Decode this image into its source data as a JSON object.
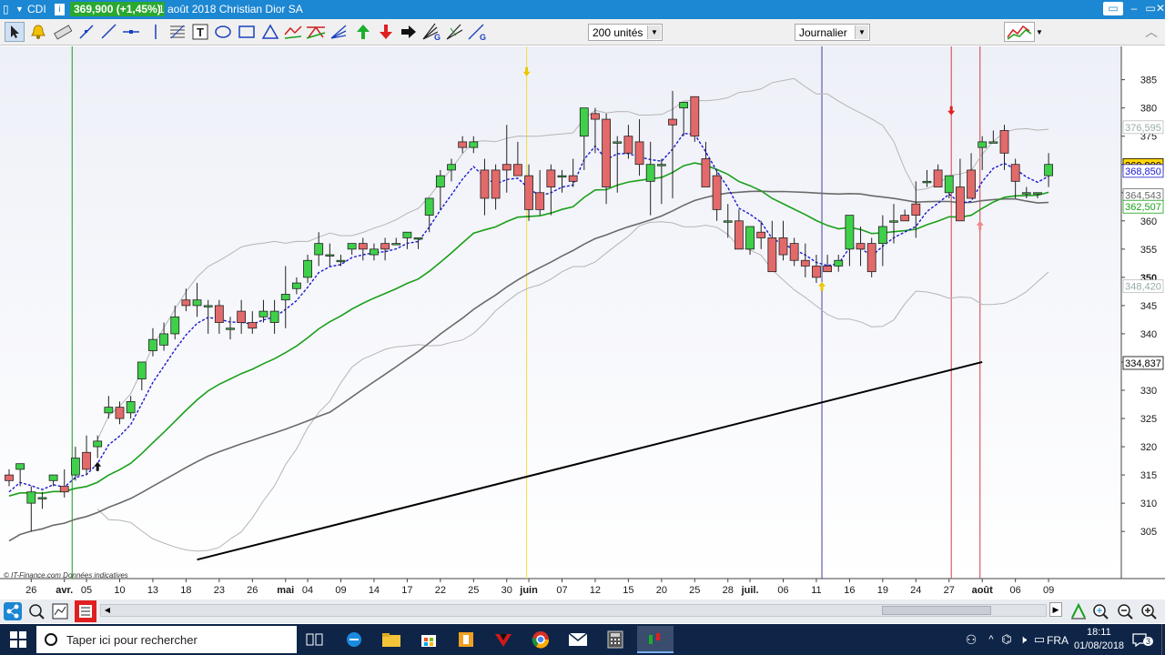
{
  "window": {
    "symbol": "CDI",
    "quote": "369,900 (+1,45%)",
    "title": "1 août 2018 Christian Dior SA",
    "controls": [
      "–",
      "▭",
      "✕"
    ]
  },
  "toolbar": {
    "units_value": "200 unités",
    "period_value": "Journalier"
  },
  "chart_data": {
    "type": "candlestick",
    "copyright": "© IT-Finance.com  Données indicatives",
    "ylim": [
      301,
      388
    ],
    "y_ticks": [
      305,
      310,
      315,
      320,
      325,
      330,
      335,
      340,
      345,
      350,
      355,
      360,
      365,
      370,
      375,
      380,
      385
    ],
    "x_labels": [
      {
        "i": 2,
        "t": "26"
      },
      {
        "i": 5,
        "t": "avr.",
        "bold": true
      },
      {
        "i": 7,
        "t": "05"
      },
      {
        "i": 10,
        "t": "10"
      },
      {
        "i": 13,
        "t": "13"
      },
      {
        "i": 16,
        "t": "18"
      },
      {
        "i": 19,
        "t": "23"
      },
      {
        "i": 22,
        "t": "26"
      },
      {
        "i": 25,
        "t": "mai",
        "bold": true
      },
      {
        "i": 27,
        "t": "04"
      },
      {
        "i": 30,
        "t": "09"
      },
      {
        "i": 33,
        "t": "14"
      },
      {
        "i": 36,
        "t": "17"
      },
      {
        "i": 39,
        "t": "22"
      },
      {
        "i": 42,
        "t": "25"
      },
      {
        "i": 45,
        "t": "30"
      },
      {
        "i": 47,
        "t": "juin",
        "bold": true
      },
      {
        "i": 50,
        "t": "07"
      },
      {
        "i": 53,
        "t": "12"
      },
      {
        "i": 56,
        "t": "15"
      },
      {
        "i": 59,
        "t": "20"
      },
      {
        "i": 62,
        "t": "25"
      },
      {
        "i": 65,
        "t": "28"
      },
      {
        "i": 67,
        "t": "juil.",
        "bold": true
      },
      {
        "i": 70,
        "t": "06"
      },
      {
        "i": 73,
        "t": "11"
      },
      {
        "i": 76,
        "t": "16"
      },
      {
        "i": 79,
        "t": "19"
      },
      {
        "i": 82,
        "t": "24"
      },
      {
        "i": 85,
        "t": "27"
      },
      {
        "i": 88,
        "t": "août",
        "bold": true
      },
      {
        "i": 91,
        "t": "06"
      },
      {
        "i": 94,
        "t": "09"
      }
    ],
    "candles": [
      [
        315,
        316,
        313,
        314
      ],
      [
        316,
        317,
        313,
        317
      ],
      [
        310,
        313,
        305,
        312
      ],
      [
        311,
        312,
        309,
        311
      ],
      [
        314,
        315,
        313,
        315
      ],
      [
        313,
        316,
        311,
        312
      ],
      [
        315,
        320,
        314,
        318
      ],
      [
        319,
        322,
        315,
        316
      ],
      [
        320,
        322,
        318,
        321
      ],
      [
        326,
        329,
        325,
        327
      ],
      [
        327,
        328,
        324,
        325
      ],
      [
        326,
        329,
        325,
        328
      ],
      [
        332,
        335,
        330,
        335
      ],
      [
        337,
        341,
        336,
        339
      ],
      [
        338,
        342,
        337,
        340
      ],
      [
        340,
        345,
        339,
        343
      ],
      [
        346,
        348,
        344,
        345
      ],
      [
        345,
        349,
        343,
        346
      ],
      [
        345,
        346,
        340,
        345
      ],
      [
        345,
        346,
        340,
        342
      ],
      [
        341,
        343,
        339,
        341
      ],
      [
        344,
        346,
        340,
        342
      ],
      [
        342,
        344,
        340,
        341
      ],
      [
        343,
        346,
        342,
        344
      ],
      [
        342,
        346,
        340,
        344
      ],
      [
        346,
        352,
        341,
        347
      ],
      [
        348,
        350,
        347,
        349
      ],
      [
        350,
        354,
        349,
        353
      ],
      [
        354,
        358,
        352,
        356
      ],
      [
        354,
        356,
        352,
        354
      ],
      [
        353,
        354,
        352,
        353
      ],
      [
        355,
        356,
        354,
        356
      ],
      [
        356,
        357,
        353,
        355
      ],
      [
        354,
        356,
        353,
        355
      ],
      [
        356,
        357,
        353,
        355
      ],
      [
        356,
        357,
        356,
        356
      ],
      [
        357,
        358,
        355,
        358
      ],
      [
        357,
        357,
        355,
        357
      ],
      [
        361,
        364,
        358,
        364
      ],
      [
        366,
        369,
        362,
        368
      ],
      [
        369,
        371,
        367,
        370
      ],
      [
        374,
        375,
        372,
        373
      ],
      [
        373,
        375,
        372,
        374
      ],
      [
        369,
        371,
        361,
        364
      ],
      [
        369,
        370,
        362,
        364
      ],
      [
        370,
        377,
        365,
        369
      ],
      [
        370,
        374,
        368,
        368
      ],
      [
        368,
        370,
        360,
        362
      ],
      [
        365,
        369,
        361,
        362
      ],
      [
        369,
        370,
        361,
        366
      ],
      [
        368,
        369,
        365,
        368
      ],
      [
        368,
        371,
        366,
        367
      ],
      [
        375,
        380,
        369,
        380
      ],
      [
        379,
        380,
        372,
        378
      ],
      [
        378,
        379,
        363,
        366
      ],
      [
        374,
        375,
        365,
        374
      ],
      [
        375,
        377,
        371,
        372
      ],
      [
        374,
        378,
        368,
        370
      ],
      [
        367,
        374,
        361,
        370
      ],
      [
        370,
        371,
        363,
        370
      ],
      [
        378,
        383,
        364,
        377
      ],
      [
        380,
        381,
        375,
        381
      ],
      [
        382,
        382,
        374,
        375
      ],
      [
        371,
        374,
        367,
        366
      ],
      [
        368,
        369,
        360,
        362
      ],
      [
        360,
        363,
        357,
        360
      ],
      [
        360,
        362,
        356,
        355
      ],
      [
        355,
        359,
        354,
        359
      ],
      [
        358,
        360,
        355,
        357
      ],
      [
        357,
        360,
        351,
        351
      ],
      [
        357,
        360,
        353,
        354
      ],
      [
        356,
        357,
        352,
        353
      ],
      [
        353,
        356,
        350,
        352
      ],
      [
        352,
        354,
        349,
        350
      ],
      [
        352,
        354,
        351,
        351
      ],
      [
        352,
        354,
        351,
        353
      ],
      [
        355,
        361,
        352,
        361
      ],
      [
        356,
        359,
        352,
        355
      ],
      [
        356,
        357,
        350,
        351
      ],
      [
        356,
        361,
        352,
        359
      ],
      [
        360,
        363,
        356,
        360
      ],
      [
        361,
        362,
        360,
        360
      ],
      [
        363,
        367,
        357,
        361
      ],
      [
        367,
        369,
        366,
        367
      ],
      [
        369,
        370,
        368,
        366
      ],
      [
        365,
        368,
        364,
        368
      ],
      [
        366,
        371,
        362,
        360
      ],
      [
        369,
        372,
        367,
        364
      ],
      [
        373,
        375,
        369,
        374
      ],
      [
        374,
        376,
        374,
        374
      ],
      [
        376,
        377,
        369,
        372
      ],
      [
        370,
        371,
        364,
        367
      ],
      [
        365,
        366,
        364,
        365
      ],
      [
        365,
        365,
        364,
        365
      ],
      [
        368,
        372,
        366,
        370
      ]
    ],
    "overlays": {
      "mm200": {
        "from": 17,
        "to": 88,
        "start": 300,
        "end": 335,
        "color": "#000000"
      },
      "mm50": {
        "from": 0,
        "to": 88,
        "color": "#6a6a6a"
      },
      "mm20": {
        "from": 0,
        "to": 88,
        "color": "#1aa01a"
      },
      "mm5": {
        "from": 0,
        "to": 88,
        "color": "#1a1ad0"
      },
      "bollinger": {
        "color": "#b5b5b5"
      }
    },
    "vertical_lines": [
      {
        "i": 5.7,
        "color": "#1a9a1a"
      },
      {
        "i": 46.8,
        "color": "#f0dd40"
      },
      {
        "i": 73.5,
        "color": "#4040a0"
      },
      {
        "i": 85.2,
        "color": "#d04040"
      },
      {
        "i": 87.8,
        "color": "#d04040"
      }
    ],
    "right_labels": [
      {
        "v": 376.595,
        "t": "376,595",
        "fill": "#ffffff",
        "color": "#9aa"
      },
      {
        "v": 369.9,
        "t": "369,900",
        "fill": "#ffd700",
        "color": "#000000"
      },
      {
        "v": 368.85,
        "t": "368,850",
        "fill": "#ffffff",
        "color": "#1a1ad0"
      },
      {
        "v": 364.543,
        "t": "364,543",
        "fill": "#ffffff",
        "color": "#6a6a6a"
      },
      {
        "v": 362.507,
        "t": "362,507",
        "fill": "#ffffff",
        "color": "#1aa01a"
      },
      {
        "v": 348.42,
        "t": "348,420",
        "fill": "#ffffff",
        "color": "#9aa"
      },
      {
        "v": 334.837,
        "t": "334,837",
        "fill": "#ffffff",
        "color": "#000000"
      }
    ]
  },
  "taskbar": {
    "search_placeholder": "Taper ici pour rechercher",
    "language": "FRA",
    "time": "18:11",
    "date": "01/08/2018",
    "notif_count": "3"
  }
}
